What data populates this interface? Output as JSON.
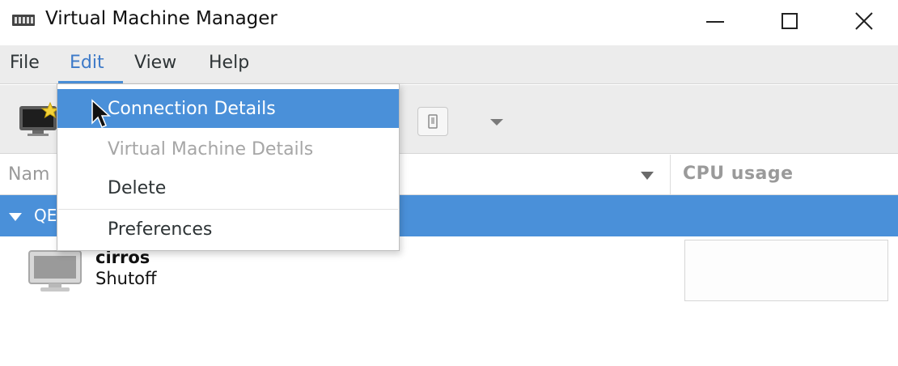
{
  "window": {
    "title": "Virtual Machine Manager",
    "app_icon": "vmm-app-icon",
    "controls": {
      "minimize_icon": "minimize-icon",
      "maximize_icon": "maximize-icon",
      "close_icon": "close-icon"
    }
  },
  "menubar": {
    "items": [
      {
        "label": "File"
      },
      {
        "label": "Edit"
      },
      {
        "label": "View"
      },
      {
        "label": "Help"
      }
    ],
    "open_menu": "Edit"
  },
  "edit_menu": {
    "items": [
      {
        "label": "Connection Details",
        "state": "highlighted"
      },
      {
        "label": "Virtual Machine Details",
        "state": "disabled"
      },
      {
        "label": "Delete",
        "state": "enabled"
      },
      {
        "label": "Preferences",
        "state": "enabled"
      }
    ]
  },
  "toolbar": {
    "new_vm_icon": "new-vm-icon",
    "button_icon": "shutdown-icon",
    "dropdown_icon": "chevron-down-icon"
  },
  "columns": {
    "name_header": "Nam",
    "cpu_header": "CPU usage"
  },
  "connections": [
    {
      "label": "QE",
      "vms": [
        {
          "name": "cirros",
          "status": "Shutoff",
          "icon": "vm-monitor-icon"
        }
      ]
    }
  ],
  "colors": {
    "accent": "#4a90d9",
    "menubar_bg": "#ececec",
    "disabled_text": "#a6a6a6"
  }
}
